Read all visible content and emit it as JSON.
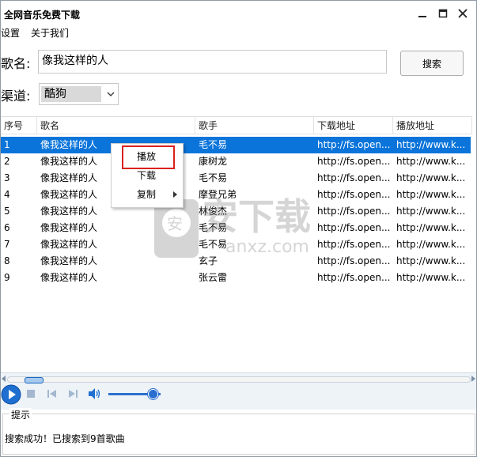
{
  "window": {
    "title": "全网音乐免费下载"
  },
  "menubar": {
    "items": [
      "设置",
      "关于我们"
    ]
  },
  "search": {
    "label": "歌名:",
    "value": "像我这样的人",
    "button": "搜索"
  },
  "channel": {
    "label": "渠道:",
    "selected": "酷狗"
  },
  "table": {
    "columns": [
      "序号",
      "歌名",
      "歌手",
      "下载地址",
      "播放地址"
    ],
    "rows": [
      [
        "1",
        "像我这样的人",
        "毛不易",
        "http://fs.open...",
        "http://www.k..."
      ],
      [
        "2",
        "像我这样的人",
        "康树龙",
        "http://fs.open...",
        "http://www.k..."
      ],
      [
        "3",
        "像我这样的人",
        "毛不易",
        "http://fs.open...",
        "http://www.k..."
      ],
      [
        "4",
        "像我这样的人",
        "摩登兄弟",
        "http://fs.open...",
        "http://www.k..."
      ],
      [
        "5",
        "像我这样的人",
        "林俊杰",
        "http://fs.open...",
        "http://www.k..."
      ],
      [
        "6",
        "像我这样的人",
        "毛不易",
        "http://fs.open...",
        "http://www.k..."
      ],
      [
        "7",
        "像我这样的人",
        "毛不易",
        "http://fs.open...",
        "http://www.k..."
      ],
      [
        "8",
        "像我这样的人",
        "玄子",
        "http://fs.open...",
        "http://www.k..."
      ],
      [
        "9",
        "像我这样的人",
        "张云雷",
        "http://fs.open...",
        "http://www.k..."
      ]
    ],
    "selected_row": 1
  },
  "context_menu": {
    "items": [
      "播放",
      "下载",
      "复制"
    ]
  },
  "watermark": {
    "text": "安下载",
    "sub": "anxz.com"
  },
  "player": {
    "volume": 0.85,
    "progress": 0.02
  },
  "status_group": {
    "title": "提示",
    "message": "搜索成功！已搜索到9首歌曲"
  },
  "colors": {
    "selection": "#0a74da",
    "highlight_box": "#d9211e",
    "accent": "#2a6fcf"
  }
}
